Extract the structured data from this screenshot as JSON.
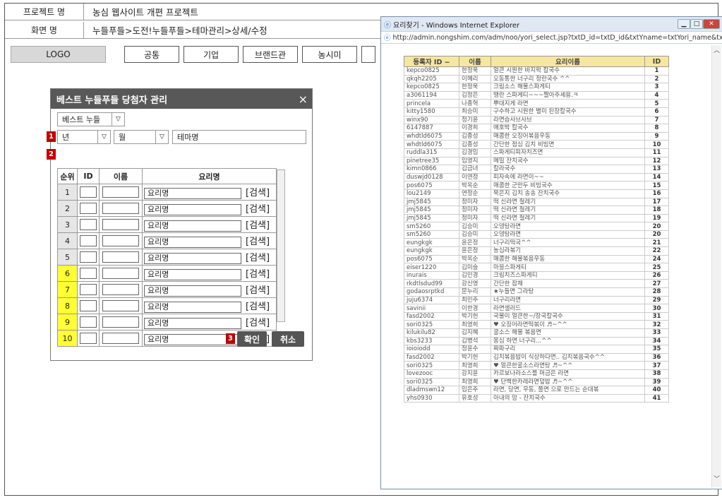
{
  "header": {
    "project_label": "프로젝트 명",
    "project_value": "농심 웹사이트 개편 프로젝트",
    "screen_label": "화면 명",
    "screen_value": "누들푸들>도전!누들푸들>테마관리>상세/수정"
  },
  "nav": {
    "logo": "LOGO",
    "items": [
      "공통",
      "기업",
      "브랜드관",
      "농시미"
    ]
  },
  "popup": {
    "title": "베스트 누들푸들 당첨자 관리",
    "close": "×",
    "type_select": "베스트 누들",
    "year": "년",
    "month": "월",
    "theme_placeholder": "테마명",
    "badges": [
      "1",
      "2",
      "3"
    ],
    "col_rank": "순위",
    "col_id": "ID",
    "col_name": "이름",
    "col_recipe": "요리명",
    "rows": [
      {
        "rank": "1",
        "recipe": "요리명",
        "search": "[검색]",
        "highlight": false
      },
      {
        "rank": "2",
        "recipe": "요리명",
        "search": "[검색]",
        "highlight": false
      },
      {
        "rank": "3",
        "recipe": "요리명",
        "search": "[검색]",
        "highlight": false
      },
      {
        "rank": "4",
        "recipe": "요리명",
        "search": "[검색]",
        "highlight": false
      },
      {
        "rank": "5",
        "recipe": "요리명",
        "search": "[검색]",
        "highlight": false
      },
      {
        "rank": "6",
        "recipe": "요리명",
        "search": "[검색]",
        "highlight": true
      },
      {
        "rank": "7",
        "recipe": "요리명",
        "search": "[검색]",
        "highlight": true
      },
      {
        "rank": "8",
        "recipe": "요리명",
        "search": "[검색]",
        "highlight": true
      },
      {
        "rank": "9",
        "recipe": "요리명",
        "search": "[검색]",
        "highlight": true
      },
      {
        "rank": "10",
        "recipe": "요리명",
        "search": "[검색]",
        "highlight": true
      }
    ],
    "ok": "확인",
    "cancel": "취소"
  },
  "ie": {
    "title": "요리찾기 - Windows Internet Explorer",
    "url": "http://admin.nongshim.com/adm/noo/yori_select.jsp?txtD_id=txtD_id&txtYname=txtYori_name&txtUser_id=txtUser_",
    "col_id": "등록자 ID ~",
    "col_name": "이름",
    "col_dish": "요리이름",
    "col_no": "ID",
    "rows": [
      [
        "kepco0825",
        "한정욱",
        "얼큰 시원한 바지락 칼국수",
        "1"
      ],
      [
        "qkqh2205",
        "이혜리",
        "오동통한 너구리 정란국수 ^^",
        "2"
      ],
      [
        "kepco0825",
        "한정욱",
        "크림소스 해물스파게티",
        "3"
      ],
      [
        "a3061194",
        "김정은",
        "땡란 스파게티~~~짤아주세용.ㅋ",
        "4"
      ],
      [
        "princela",
        "나종혁",
        "뿌대지게 라면",
        "5"
      ],
      [
        "kitty1580",
        "최승미",
        "구수하고 시원한 별미 된장칼국수",
        "6"
      ],
      [
        "winx90",
        "정기윤",
        "라면습사브사브",
        "7"
      ],
      [
        "6147887",
        "이경희",
        "애호박 칼국수",
        "8"
      ],
      [
        "whdtld6075",
        "김종성",
        "매콤한 오징어볶음우동",
        "9"
      ],
      [
        "whdtld6075",
        "김종성",
        "간단한 점심 김치 비빔면",
        "10"
      ],
      [
        "ruddla315",
        "김경임",
        "스파게티피자치즈면",
        "11"
      ],
      [
        "pinetree35",
        "임영지",
        "메밀 잔치국수",
        "12"
      ],
      [
        "kimn0866",
        "김금녀",
        "칼라국수",
        "13"
      ],
      [
        "duswjd0128",
        "이연정",
        "피자속에 라면이~~",
        "14"
      ],
      [
        "pos6075",
        "박옥순",
        "매콤한 군만두 비빔국수",
        "15"
      ],
      [
        "lou2149",
        "연정순",
        "묵은지 김치 송송 잔치국수",
        "16"
      ],
      [
        "jmj5845",
        "정미자",
        "떡 신라면 철레기",
        "17"
      ],
      [
        "jmj5845",
        "정미자",
        "떡 신라면 철레기",
        "18"
      ],
      [
        "jmj5845",
        "정미자",
        "떡 신라면 철레기",
        "19"
      ],
      [
        "sm5260",
        "김승미",
        "오뎅탕라면",
        "20"
      ],
      [
        "sm5260",
        "김승미",
        "오뎅탕라면",
        "20"
      ],
      [
        "eungkgk",
        "윤은정",
        "너구리떡국^^",
        "21"
      ],
      [
        "eungkgk",
        "윤은정",
        "농심라볶기",
        "22"
      ],
      [
        "pos6075",
        "박옥순",
        "매콤한 해물볶음우동",
        "24"
      ],
      [
        "eiser1220",
        "김미슬",
        "마블스파게티",
        "25"
      ],
      [
        "inurais",
        "김민경",
        "크림치즈스파게티",
        "26"
      ],
      [
        "rkdtlsdud99",
        "강신영",
        "간단한 잡채",
        "27"
      ],
      [
        "godaosrptkd",
        "문누리",
        "★누들면 그라탕",
        "28"
      ],
      [
        "juju6374",
        "최민주",
        "너구리라면",
        "29"
      ],
      [
        "savinii",
        "이한경",
        "라면샐러드",
        "30"
      ],
      [
        "fasd2002",
        "박기헌",
        "국물이 얼큰한~/장국칼국수",
        "31"
      ],
      [
        "sori0325",
        "최영희",
        "♥ 오징어라면떡볶이 ♬~^^",
        "32"
      ],
      [
        "kilukilu82",
        "김지혜",
        "굴소스 해물 볶음면",
        "33"
      ],
      [
        "kbs3233",
        "김병석",
        "몽심 하면 너구리...^^",
        "34"
      ],
      [
        "ioioiodd",
        "정윤수",
        "짜파구리",
        "35"
      ],
      [
        "fasd2002",
        "박기헌",
        "김치볶음밥이 식상하다면.. 김치볶음국수^^",
        "36"
      ],
      [
        "sori0325",
        "최영희",
        "♥ 얼큰한굴소스라면탕 ♬~^^",
        "37"
      ],
      [
        "lovezooc",
        "강지윤",
        "카르보나라소스를 머금은 라면",
        "38"
      ],
      [
        "sori0325",
        "최영희",
        "♥ 단백한카레라면덮밥 ♬~^^",
        "39"
      ],
      [
        "dladmswn12",
        "임은주",
        "라면, 당면, 우동, 쫄면 으로 만드는 순대볶",
        "40"
      ],
      [
        "yhs0930",
        "유호성",
        "아내의 맘 - 잔치국수",
        "41"
      ]
    ]
  }
}
